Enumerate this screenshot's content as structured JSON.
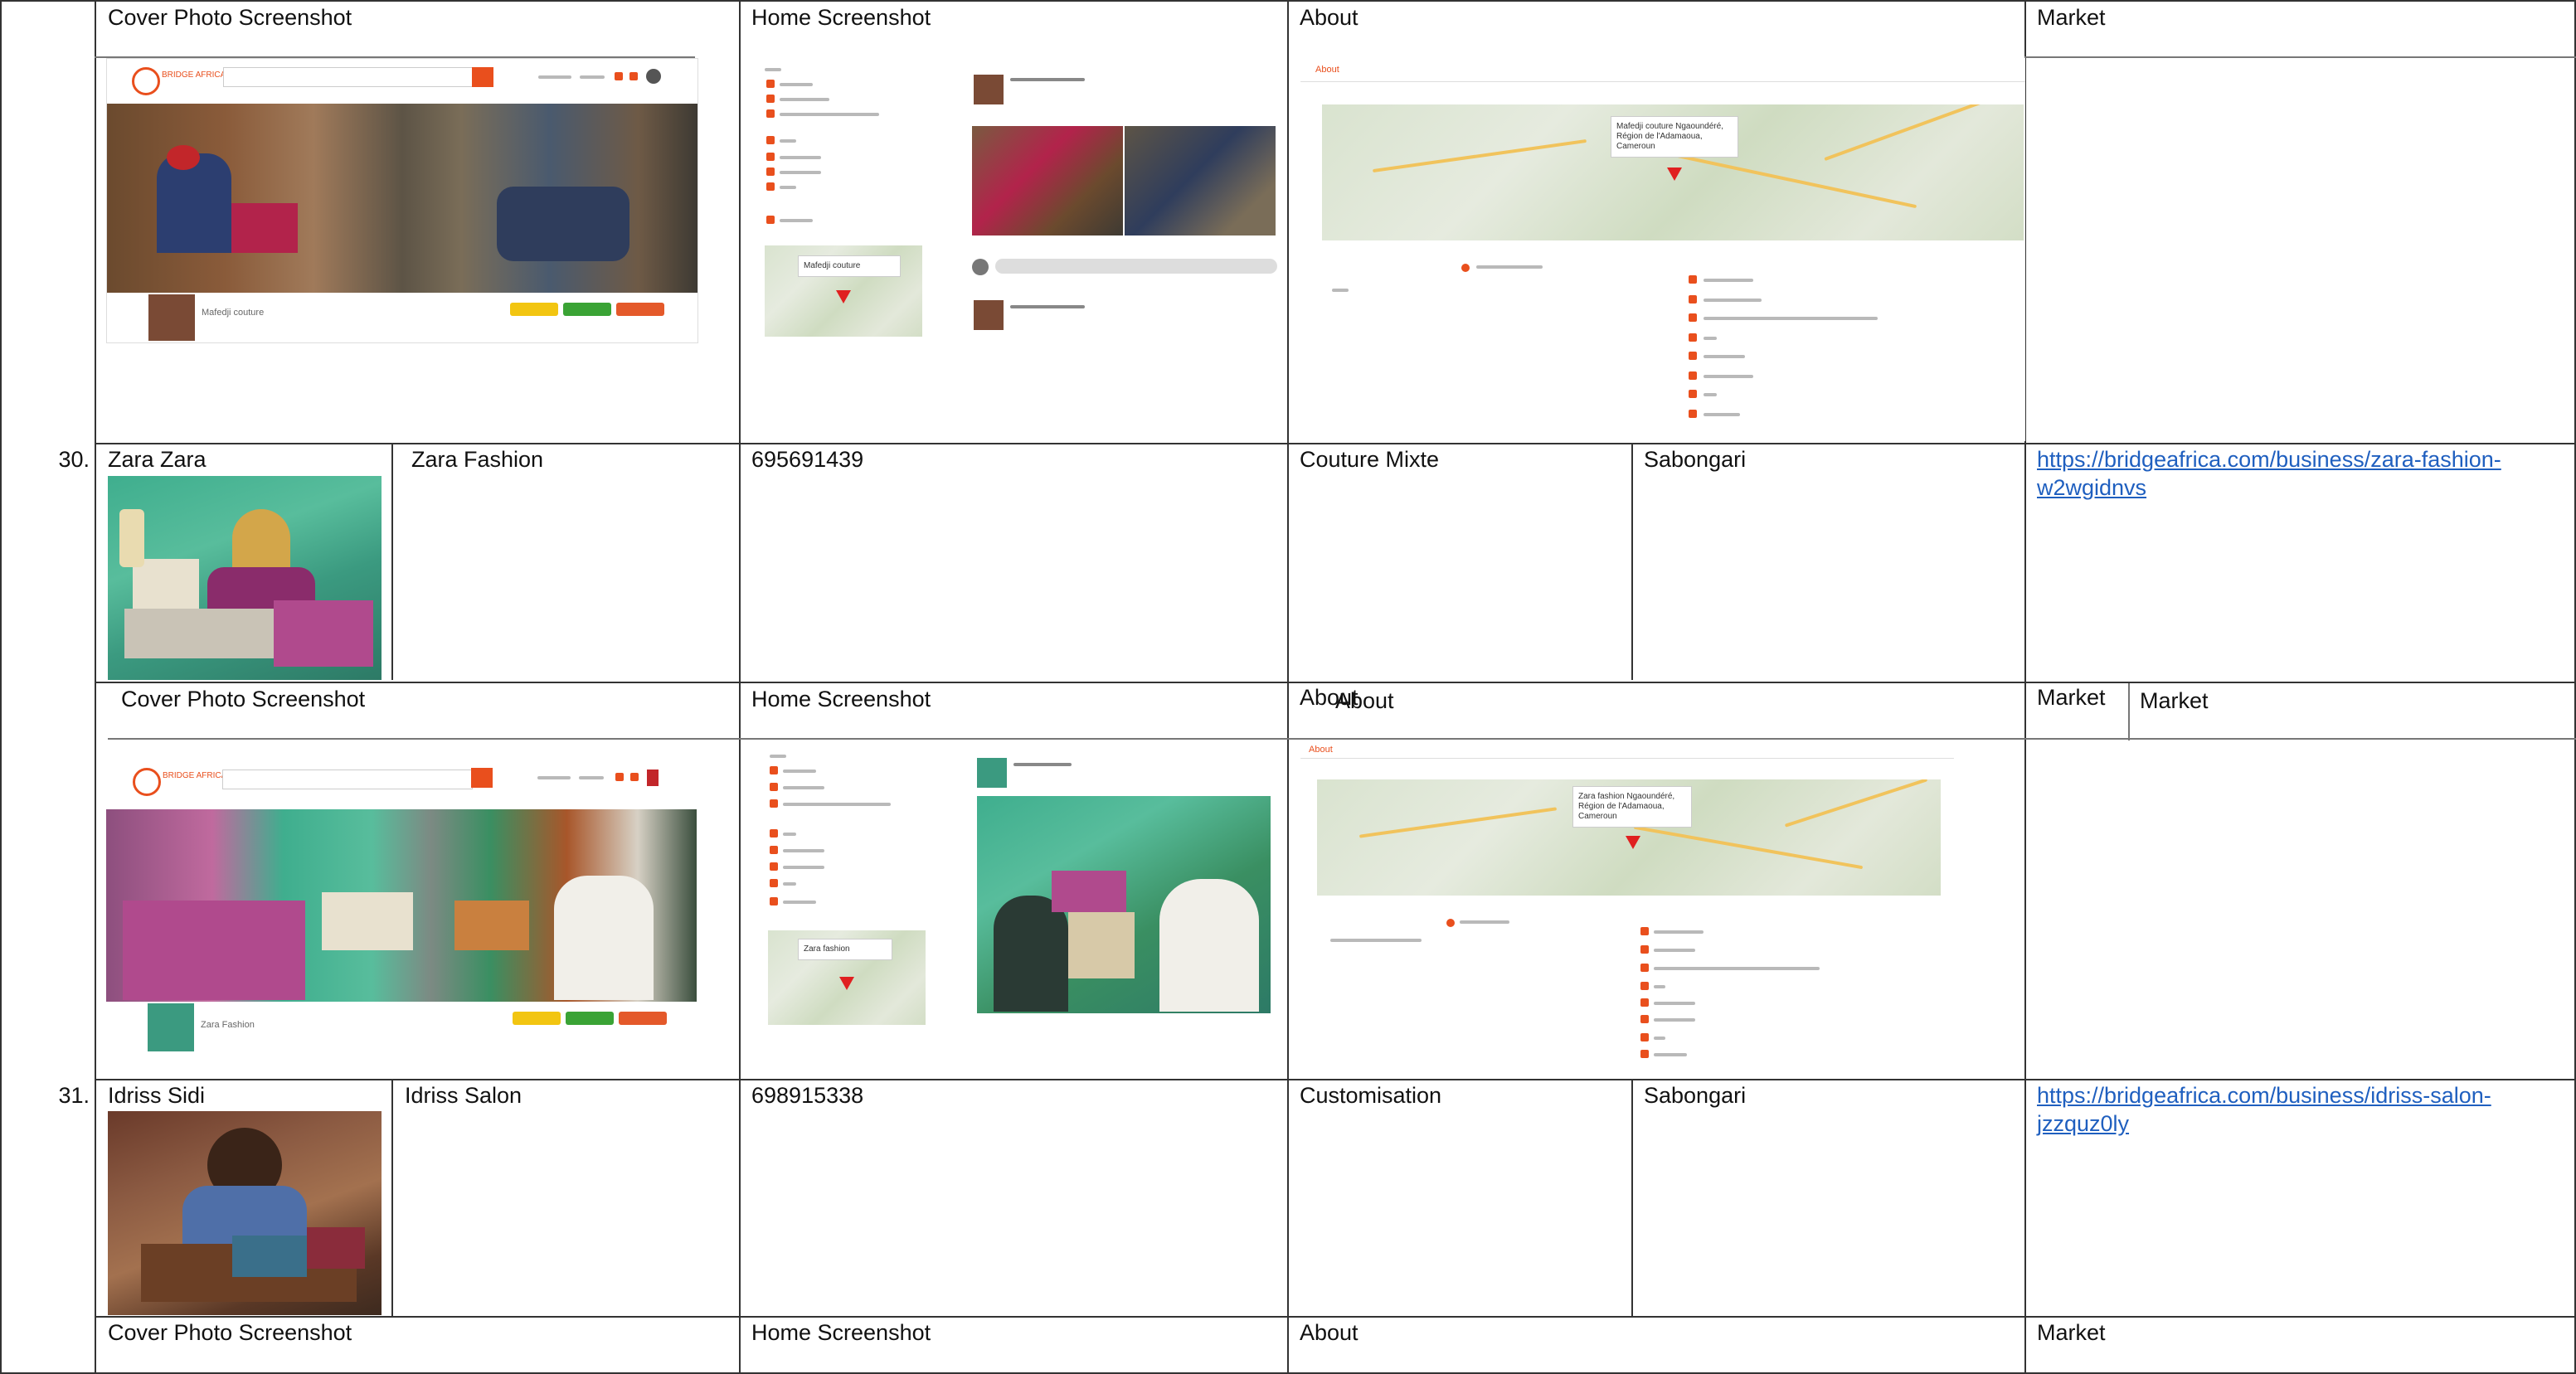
{
  "headers": {
    "cover": "Cover Photo Screenshot",
    "home": "Home Screenshot",
    "about": "About",
    "market": "Market"
  },
  "rows": [
    {
      "number": "30.",
      "owner": "Zara Zara",
      "business": "Zara Fashion",
      "phone": "695691439",
      "category": "Couture Mixte",
      "location": "Sabongari",
      "url": "https://bridgeafrica.com/business/zara-fashion-w2wgidnvs"
    },
    {
      "number": "31.",
      "owner": "Idriss Sidi",
      "business": "Idriss Salon",
      "phone": "698915338",
      "category": "Customisation",
      "location": "Sabongari",
      "url": "https://bridgeafrica.com/business/idriss-salon-jzzquz0ly"
    }
  ],
  "thumbs": {
    "logo_text": "BRIDGE AFRICA",
    "biz_name_1": "Mafedji couture",
    "biz_name_2": "Zara Fashion",
    "map_label_1": "Mafedji couture Ngaoundéré, Région de l'Adamaoua, Cameroun",
    "map_label_2": "Zara fashion Ngaoundéré, Région de l'Adamaoua, Cameroun",
    "about_label": "About"
  },
  "colors": {
    "brand_orange": "#e94f1d",
    "btn_yellow": "#f2c511",
    "btn_green": "#3aa335",
    "btn_orange": "#e4592a",
    "link_blue": "#1f5fbf"
  }
}
